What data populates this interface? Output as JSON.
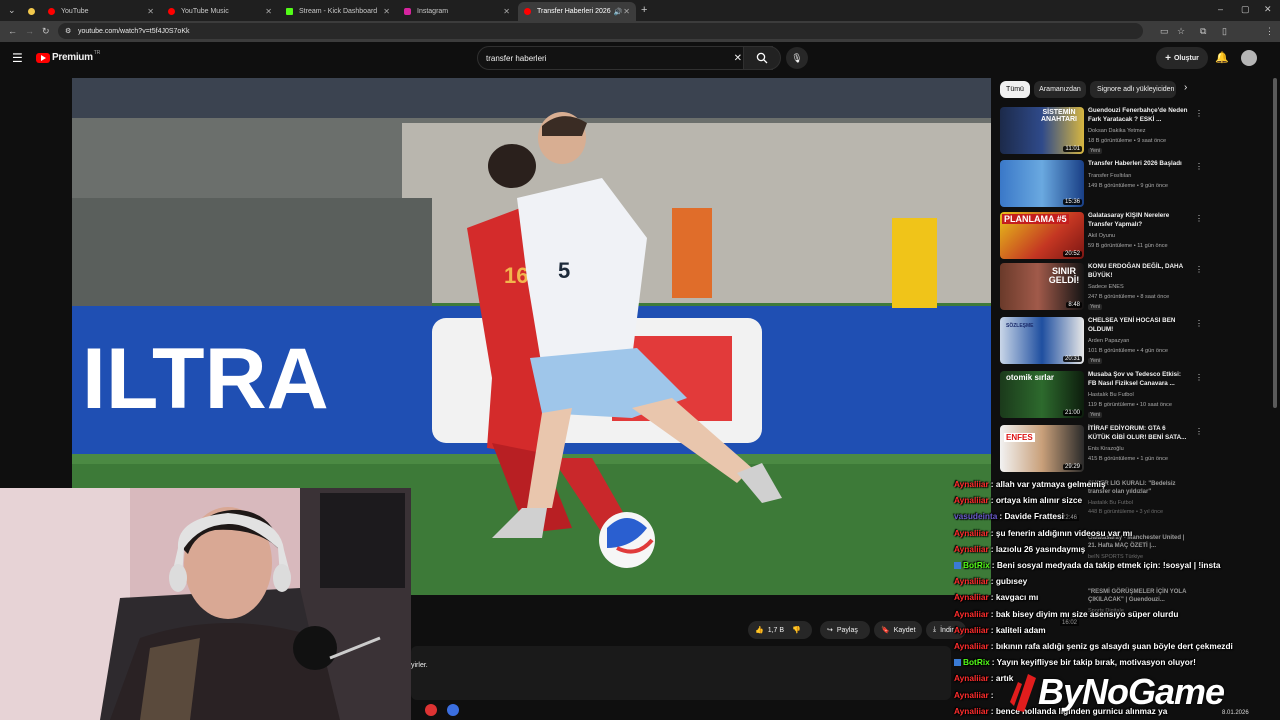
{
  "browser": {
    "tabs": [
      {
        "label": "YouTube",
        "color": "#ff0000"
      },
      {
        "label": "YouTube Music",
        "color": "#ff0000"
      },
      {
        "label": "Stream - Kick Dashboard",
        "color": "#53fc18"
      },
      {
        "label": "Instagram",
        "color": "#d6249f"
      },
      {
        "label": "Transfer Haberleri 2026",
        "color": "#ff0000"
      }
    ],
    "url": "youtube.com/watch?v=t5f4J0S7oKk"
  },
  "yt": {
    "logo_text": "Premium",
    "logo_sup": "TR",
    "search_value": "transfer haberleri",
    "create_label": "Oluştur"
  },
  "video": {
    "sign_text": "ILTRA",
    "jersey_left": "16",
    "jersey_right": "5"
  },
  "chips": [
    "Tümü",
    "Aramanızdan",
    "Signore adlı yükleyiciden"
  ],
  "recs": [
    {
      "title": "Guendouzi Fenerbahçe'de Neden Fark Yaratacak ? ESKİ ...",
      "channel": "Doksan Dakika Yetmez",
      "meta": "18 B görüntüleme • 9 saat önce",
      "badge": "Yeni",
      "duration": "11:01",
      "thumb_text": "SİSTEMİN ANAHTARI"
    },
    {
      "title": "Transfer Haberleri 2026 Başladı",
      "channel": "Transfer Fısıltıları",
      "meta": "149 B görüntüleme • 9 gün önce",
      "badge": "",
      "duration": "15:36",
      "thumb_text": ""
    },
    {
      "title": "Galatasaray KIŞIN Nerelere Transfer Yapmalı?",
      "channel": "Akil Oyunu",
      "meta": "59 B görüntüleme • 11 gün önce",
      "badge": "",
      "duration": "20:52",
      "thumb_text": "PLANLAMA #5"
    },
    {
      "title": "KONU ERDOĞAN DEĞİL, DAHA BÜYÜK!",
      "channel": "Sadece ENES",
      "meta": "247 B görüntüleme • 8 saat önce",
      "badge": "Yeni",
      "duration": "8:48",
      "thumb_text": "SINIR GELDİ!"
    },
    {
      "title": "CHELSEA YENİ HOCASI BEN OLDUM!",
      "channel": "Arden Papazyan",
      "meta": "101 B görüntüleme • 4 gün önce",
      "badge": "Yeni",
      "duration": "20:31",
      "thumb_text": "SÖZLEŞME"
    },
    {
      "title": "Musaba Şov ve Tedesco Etkisi: FB Nasıl Fiziksel Canavara ...",
      "channel": "Hastalık Bu Futbol",
      "meta": "119 B görüntüleme • 10 saat önce",
      "badge": "Yeni",
      "duration": "21:00",
      "thumb_text": "otomik sırlar"
    },
    {
      "title": "İTİRAF EDİYORUM: GTA 6 KÜTÜK GİBİ OLUR! BENİ SATA...",
      "channel": "Enis Kirazoğlu",
      "meta": "415 B görüntüleme • 1 gün önce",
      "badge": "",
      "duration": "29:29",
      "thumb_text": "ENFES"
    }
  ],
  "actions": {
    "likes": "1,7 B",
    "share": "Paylaş",
    "save": "Kaydet",
    "download": "İndir"
  },
  "desc_fragment": "yirler.",
  "overlay": {
    "brand": "ByNoGame",
    "date": "8.01.2026"
  },
  "chat": [
    {
      "user": "Aynaliiar",
      "color": "#ff2d2d",
      "msg": "allah var yatmaya gelmemiş",
      "bot": false
    },
    {
      "user": "Aynaliiar",
      "color": "#ff2d2d",
      "msg": "ortaya kim alınır sizce",
      "bot": false
    },
    {
      "user": "vasudeinta",
      "color": "#6a5acd",
      "msg": "Davide Frattesi",
      "bot": false
    },
    {
      "user": "Aynaliiar",
      "color": "#ff2d2d",
      "msg": "şu fenerin aldığının videosu var mı",
      "bot": false
    },
    {
      "user": "Aynaliiar",
      "color": "#ff2d2d",
      "msg": "lazıolu 26 yasındaymış",
      "bot": false
    },
    {
      "user": "BotRix",
      "color": "#53fc18",
      "msg": "Beni sosyal medyada da takip etmek için: !sosyal | !insta",
      "bot": true
    },
    {
      "user": "Aynaliiar",
      "color": "#ff2d2d",
      "msg": "gubısey",
      "bot": false
    },
    {
      "user": "Aynaliiar",
      "color": "#ff2d2d",
      "msg": "kavgacı mı",
      "bot": false
    },
    {
      "user": "Aynaliiar",
      "color": "#ff2d2d",
      "msg": "bak bisey diyim mı size asensıyo süper olurdu",
      "bot": false
    },
    {
      "user": "Aynaliiar",
      "color": "#ff2d2d",
      "msg": "kaliteli adam",
      "bot": false
    },
    {
      "user": "Aynaliiar",
      "color": "#ff2d2d",
      "msg": "bıkının rafa aldığı şeniz gs alsaydı şuan böyle dert çekmezdi",
      "bot": false
    },
    {
      "user": "BotRix",
      "color": "#53fc18",
      "msg": "Yayın keyifliyse bir takip bırak, motivasyon oluyor!",
      "bot": true
    },
    {
      "user": "Aynaliiar",
      "color": "#ff2d2d",
      "msg": "artık",
      "bot": false
    },
    {
      "user": "Aynaliiar",
      "color": "#ff2d2d",
      "msg": "",
      "bot": false
    },
    {
      "user": "Aynaliiar",
      "color": "#ff2d2d",
      "msg": "bence hollanda liginden gurnicu alınmaz ya",
      "bot": false
    }
  ],
  "chat_behind": [
    {
      "title": "SÜPER LİG KURALI: \"Bedelsiz transfer olan yıldızlar\"",
      "channel": "Hastalık Bu Futbol",
      "meta": "448 B görüntüleme • 3 yıl önce",
      "duration": "22:46"
    },
    {
      "title": "Galatasaray - Manchester United | 21. Hafta MAÇ ÖZETİ |...",
      "channel": "beIN SPORTS Türkiye",
      "meta": "",
      "duration": ""
    },
    {
      "title": "\"RESMİ GÖRÜŞMELER İÇİN YOLA ÇIKILACAK\" | Guendouzi...",
      "channel": "Sports Digitale",
      "meta": "",
      "duration": "16:02"
    }
  ]
}
